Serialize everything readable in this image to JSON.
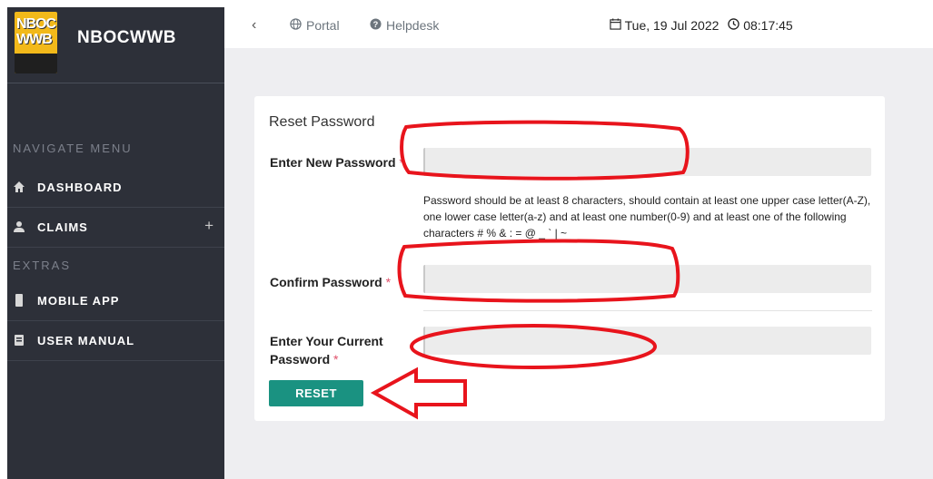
{
  "brand": {
    "logo_line1": "NBOC",
    "logo_line2": "WWB",
    "name": "NBOCWWB"
  },
  "sidebar": {
    "navigate_label": "NAVIGATE MENU",
    "extras_label": "EXTRAS",
    "items": [
      {
        "label": "DASHBOARD",
        "icon": "home-icon"
      },
      {
        "label": "CLAIMS",
        "icon": "user-icon",
        "expand": "+"
      },
      {
        "label": "MOBILE APP",
        "icon": "mobile-icon"
      },
      {
        "label": "USER MANUAL",
        "icon": "book-icon"
      }
    ]
  },
  "topbar": {
    "back": "‹",
    "portal": "Portal",
    "helpdesk": "Helpdesk",
    "date": "Tue, 19 Jul 2022",
    "time": "08:17:45"
  },
  "form": {
    "title": "Reset Password",
    "new_password_label": "Enter New Password",
    "required_mark": "*",
    "help_text": "Password should be at least 8 characters, should contain at least one upper case letter(A-Z), one lower case letter(a-z) and at least one number(0-9) and at least one of the following characters # % & : = @ _ ` | ~",
    "confirm_password_label": "Confirm Password",
    "current_password_label_line1": "Enter Your Current",
    "current_password_label_line2": "Password",
    "new_password_value": "",
    "confirm_password_value": "",
    "current_password_value": "",
    "reset_label": "RESET"
  },
  "colors": {
    "sidebar_bg": "#2d3039",
    "accent": "#1a9281",
    "annotation": "#e8141c",
    "required": "#e0506a"
  }
}
